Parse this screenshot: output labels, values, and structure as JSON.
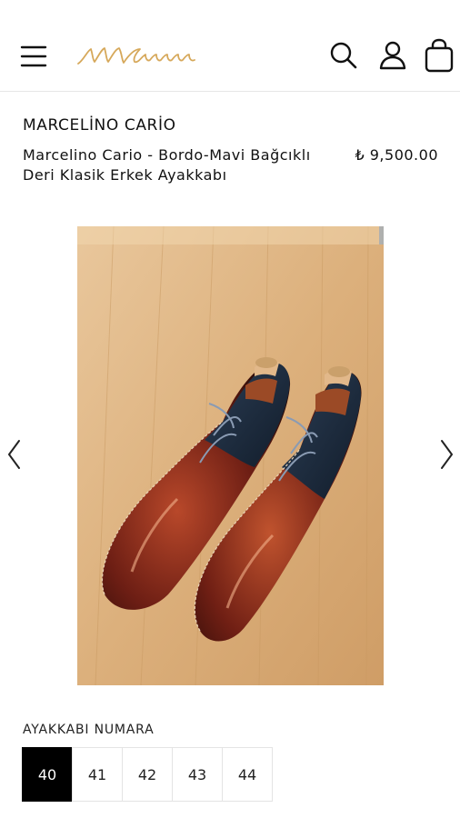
{
  "header": {
    "menu_icon": "hamburger-menu-icon",
    "logo_icon": "brand-signature-logo",
    "search_icon": "search-icon",
    "account_icon": "user-icon",
    "cart_icon": "shopping-bag-icon",
    "logo_color": "#d6a85a"
  },
  "product": {
    "brand": "MARCELİNO CARİO",
    "title": "Marcelino Cario - Bordo-Mavi Bağcıklı Deri Klasik Erkek Ayakkabı",
    "price": "₺ 9,500.00"
  },
  "gallery": {
    "prev_icon": "chevron-left-icon",
    "next_icon": "chevron-right-icon",
    "image": "burgundy-navy-leather-oxford-shoes-photo"
  },
  "size_selector": {
    "label": "AYAKKABI NUMARA",
    "options": [
      "40",
      "41",
      "42",
      "43",
      "44"
    ],
    "selected": "40"
  }
}
